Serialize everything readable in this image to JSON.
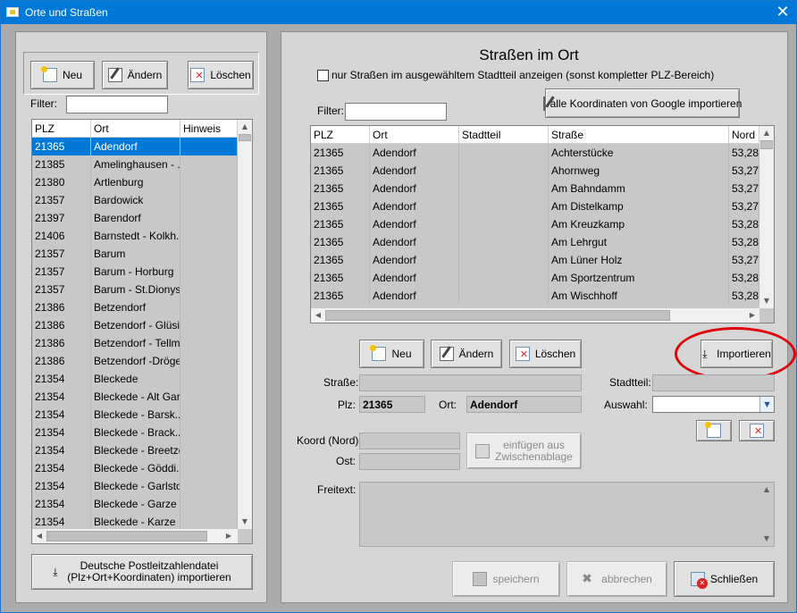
{
  "window": {
    "title": "Orte und Straßen",
    "close": "✕"
  },
  "left": {
    "buttons": {
      "new": "Neu",
      "edit": "Ändern",
      "delete": "Löschen"
    },
    "filter_label": "Filter:",
    "filter_value": "",
    "columns": [
      "PLZ",
      "Ort",
      "Hinweis"
    ],
    "rows": [
      [
        "21365",
        "Adendorf",
        ""
      ],
      [
        "21385",
        "Amelinghausen - ...",
        ""
      ],
      [
        "21380",
        "Artlenburg",
        ""
      ],
      [
        "21357",
        "Bardowick",
        ""
      ],
      [
        "21397",
        "Barendorf",
        ""
      ],
      [
        "21406",
        "Barnstedt - Kolkh...",
        ""
      ],
      [
        "21357",
        "Barum",
        ""
      ],
      [
        "21357",
        "Barum - Horburg",
        ""
      ],
      [
        "21357",
        "Barum - St.Dionys",
        ""
      ],
      [
        "21386",
        "Betzendorf",
        ""
      ],
      [
        "21386",
        "Betzendorf - Glüsi...",
        ""
      ],
      [
        "21386",
        "Betzendorf - Tellmer",
        ""
      ],
      [
        "21386",
        "Betzendorf -Dröge...",
        ""
      ],
      [
        "21354",
        "Bleckede",
        ""
      ],
      [
        "21354",
        "Bleckede - Alt Gar...",
        ""
      ],
      [
        "21354",
        "Bleckede - Barsk...",
        ""
      ],
      [
        "21354",
        "Bleckede - Brack...",
        ""
      ],
      [
        "21354",
        "Bleckede - Breetze",
        ""
      ],
      [
        "21354",
        "Bleckede - Göddi...",
        ""
      ],
      [
        "21354",
        "Bleckede - Garlstorf",
        ""
      ],
      [
        "21354",
        "Bleckede - Garze",
        ""
      ],
      [
        "21354",
        "Bleckede - Karze",
        ""
      ]
    ],
    "import_button_line1": "Deutsche Postleitzahlendatei",
    "import_button_line2": "(Plz+Ort+Koordinaten)  importieren"
  },
  "right": {
    "title": "Straßen im Ort",
    "checkbox_label": "nur Straßen im ausgewähltem Stadtteil anzeigen (sonst kompletter PLZ-Bereich)",
    "checkbox_checked": false,
    "google_button": "alle Koordinaten von Google importieren",
    "filter_label": "Filter:",
    "filter_value": "",
    "columns": [
      "PLZ",
      "Ort",
      "Stadtteil",
      "Straße",
      "Nord"
    ],
    "rows": [
      [
        "21365",
        "Adendorf",
        "",
        "Achterstücke",
        "53,28"
      ],
      [
        "21365",
        "Adendorf",
        "",
        "Ahornweg",
        "53,27"
      ],
      [
        "21365",
        "Adendorf",
        "",
        "Am Bahndamm",
        "53,27"
      ],
      [
        "21365",
        "Adendorf",
        "",
        "Am Distelkamp",
        "53,27"
      ],
      [
        "21365",
        "Adendorf",
        "",
        "Am Kreuzkamp",
        "53,28"
      ],
      [
        "21365",
        "Adendorf",
        "",
        "Am Lehrgut",
        "53,28"
      ],
      [
        "21365",
        "Adendorf",
        "",
        "Am Lüner Holz",
        "53,27"
      ],
      [
        "21365",
        "Adendorf",
        "",
        "Am Sportzentrum",
        "53,28"
      ],
      [
        "21365",
        "Adendorf",
        "",
        "Am Wischhoff",
        "53,28"
      ]
    ],
    "buttons": {
      "new": "Neu",
      "edit": "Ändern",
      "delete": "Löschen",
      "import": "Importieren"
    },
    "form": {
      "strasse_label": "Straße:",
      "strasse_value": "",
      "stadtteil_label": "Stadtteil:",
      "stadtteil_value": "",
      "plz_label": "Plz:",
      "plz_value": "21365",
      "ort_label": "Ort:",
      "ort_value": "Adendorf",
      "auswahl_label": "Auswahl:",
      "auswahl_value": "",
      "koord_nord_label": "Koord (Nord):",
      "koord_nord_value": "",
      "ost_label": "Ost:",
      "ost_value": "",
      "paste_line1": "einfügen aus",
      "paste_line2": "Zwischenablage",
      "freitext_label": "Freitext:",
      "freitext_value": ""
    },
    "save": "speichern",
    "cancel": "abbrechen",
    "close": "Schließen"
  }
}
